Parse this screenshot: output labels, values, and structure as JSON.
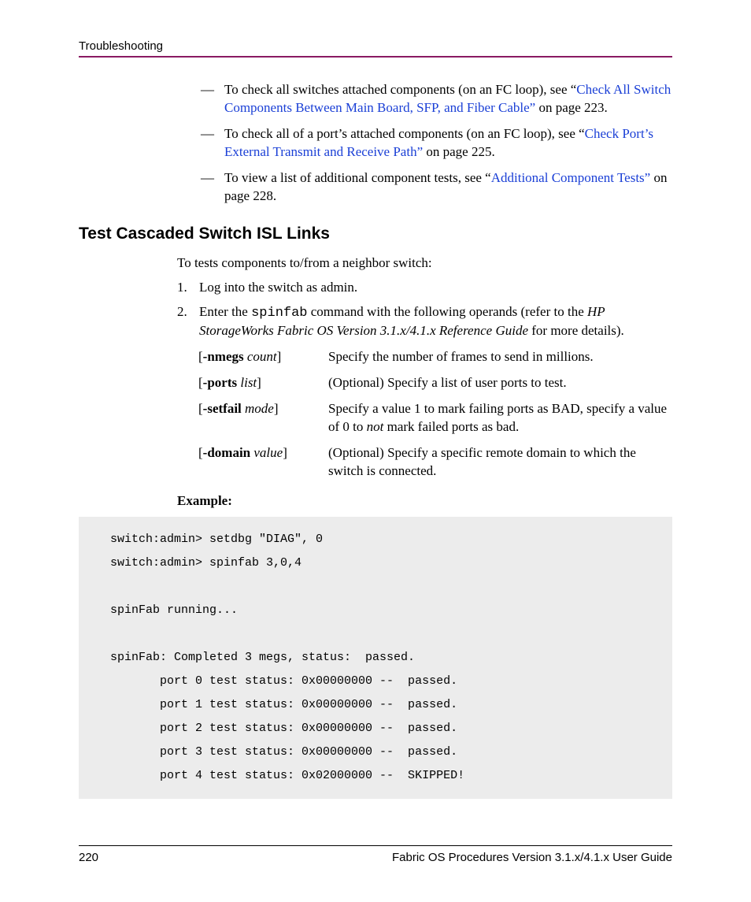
{
  "header": {
    "section": "Troubleshooting"
  },
  "bullets": {
    "b1_pre": "To check all switches attached components (on an FC loop), see “",
    "b1_link": "Check All Switch Components Between Main Board, SFP, and Fiber Cable”",
    "b1_post": " on page 223.",
    "b2_pre": "To check all of a port’s attached components (on an FC loop), see “",
    "b2_link": "Check Port’s External Transmit and Receive Path”",
    "b2_post": " on page 225.",
    "b3_pre": "To view a list of additional component tests, see “",
    "b3_link": "Additional Component Tests”",
    "b3_post": " on page 228."
  },
  "section": {
    "heading": "Test Cascaded Switch ISL Links",
    "intro": "To tests components to/from a neighbor switch:",
    "step1": "Log into the switch as admin.",
    "step2_a": "Enter the ",
    "step2_cmd": "spinfab",
    "step2_b": " command with the following operands (refer to the ",
    "step2_ref": "HP StorageWorks Fabric OS Version 3.1.x/4.1.x Reference Guide",
    "step2_c": " for more details)."
  },
  "options": {
    "r1": {
      "flag": "-nmegs",
      "arg": "count",
      "desc": "Specify the number of frames to send in millions."
    },
    "r2": {
      "flag": "-ports",
      "arg": "list",
      "desc": "(Optional) Specify a list of user ports to test."
    },
    "r3": {
      "flag": "-setfail",
      "arg": "mode",
      "desc_a": "Specify a value 1 to mark failing ports as BAD, specify a value of 0 to ",
      "desc_i": "not",
      "desc_b": " mark failed ports as bad."
    },
    "r4": {
      "flag": "-domain",
      "arg": "value",
      "desc": "(Optional) Specify a specific remote domain to which the switch is connected."
    }
  },
  "example": {
    "label": "Example:",
    "code": "switch:admin> setdbg \"DIAG\", 0\nswitch:admin> spinfab 3,0,4\n\nspinFab running...\n\nspinFab: Completed 3 megs, status:  passed.\n       port 0 test status: 0x00000000 --  passed.\n       port 1 test status: 0x00000000 --  passed.\n       port 2 test status: 0x00000000 --  passed.\n       port 3 test status: 0x00000000 --  passed.\n       port 4 test status: 0x02000000 --  SKIPPED!"
  },
  "footer": {
    "page": "220",
    "title": "Fabric OS Procedures Version 3.1.x/4.1.x User Guide"
  }
}
